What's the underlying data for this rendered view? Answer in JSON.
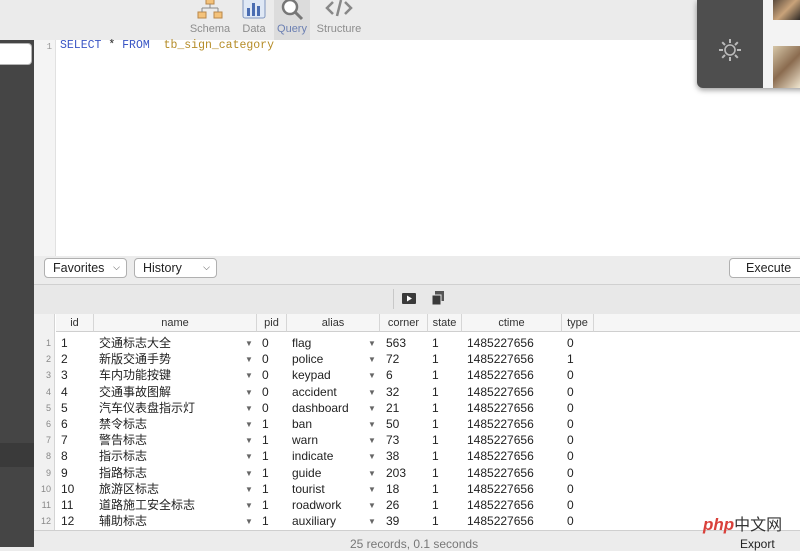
{
  "toolbar": {
    "buttons": [
      {
        "label": "Schema",
        "icon": "schema-icon"
      },
      {
        "label": "Data",
        "icon": "data-icon"
      },
      {
        "label": "Query",
        "icon": "query-icon",
        "active": true
      },
      {
        "label": "Structure",
        "icon": "structure-icon"
      }
    ]
  },
  "editor": {
    "line_number": "1",
    "keyword_select": "SELECT",
    "star": " * ",
    "keyword_from": "FROM",
    "table": "tb_sign_category"
  },
  "controls": {
    "favorites_label": "Favorites",
    "history_label": "History",
    "execute_label": "Execute"
  },
  "results": {
    "columns": [
      "id",
      "name",
      "pid",
      "alias",
      "corner",
      "state",
      "ctime",
      "type"
    ],
    "rows": [
      {
        "n": "1",
        "id": "1",
        "name": "交通标志大全",
        "pid": "0",
        "alias": "flag",
        "corner": "563",
        "state": "1",
        "ctime": "1485227656",
        "type": "0"
      },
      {
        "n": "2",
        "id": "2",
        "name": "新版交通手势",
        "pid": "0",
        "alias": "police",
        "corner": "72",
        "state": "1",
        "ctime": "1485227656",
        "type": "1"
      },
      {
        "n": "3",
        "id": "3",
        "name": "车内功能按键",
        "pid": "0",
        "alias": "keypad",
        "corner": "6",
        "state": "1",
        "ctime": "1485227656",
        "type": "0"
      },
      {
        "n": "4",
        "id": "4",
        "name": "交通事故图解",
        "pid": "0",
        "alias": "accident",
        "corner": "32",
        "state": "1",
        "ctime": "1485227656",
        "type": "0"
      },
      {
        "n": "5",
        "id": "5",
        "name": "汽车仪表盘指示灯",
        "pid": "0",
        "alias": "dashboard",
        "corner": "21",
        "state": "1",
        "ctime": "1485227656",
        "type": "0"
      },
      {
        "n": "6",
        "id": "6",
        "name": "禁令标志",
        "pid": "1",
        "alias": "ban",
        "corner": "50",
        "state": "1",
        "ctime": "1485227656",
        "type": "0"
      },
      {
        "n": "7",
        "id": "7",
        "name": "警告标志",
        "pid": "1",
        "alias": "warn",
        "corner": "73",
        "state": "1",
        "ctime": "1485227656",
        "type": "0"
      },
      {
        "n": "8",
        "id": "8",
        "name": "指示标志",
        "pid": "1",
        "alias": "indicate",
        "corner": "38",
        "state": "1",
        "ctime": "1485227656",
        "type": "0"
      },
      {
        "n": "9",
        "id": "9",
        "name": "指路标志",
        "pid": "1",
        "alias": "guide",
        "corner": "203",
        "state": "1",
        "ctime": "1485227656",
        "type": "0"
      },
      {
        "n": "10",
        "id": "10",
        "name": "旅游区标志",
        "pid": "1",
        "alias": "tourist",
        "corner": "18",
        "state": "1",
        "ctime": "1485227656",
        "type": "0"
      },
      {
        "n": "11",
        "id": "11",
        "name": "道路施工安全标志",
        "pid": "1",
        "alias": "roadwork",
        "corner": "26",
        "state": "1",
        "ctime": "1485227656",
        "type": "0"
      },
      {
        "n": "12",
        "id": "12",
        "name": "辅助标志",
        "pid": "1",
        "alias": "auxiliary",
        "corner": "39",
        "state": "1",
        "ctime": "1485227656",
        "type": "0"
      }
    ]
  },
  "status": {
    "text": "25 records, 0.1 seconds",
    "export_label": "Export"
  },
  "popup": {
    "icon": "gear-icon"
  },
  "watermark": {
    "brand": "php",
    "text": "中文网"
  }
}
